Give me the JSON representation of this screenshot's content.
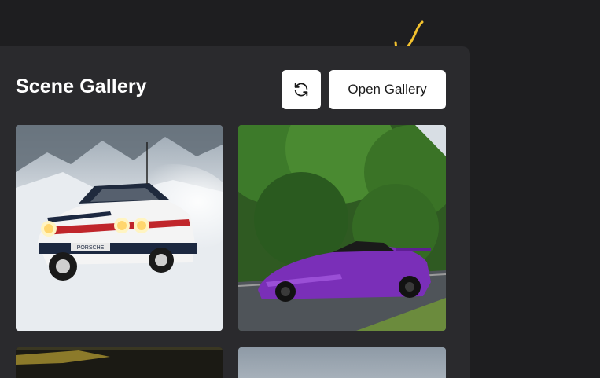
{
  "gallery": {
    "title": "Scene Gallery",
    "open_label": "Open Gallery",
    "refresh_icon": "refresh-icon",
    "annotation_icon": "arrow-annotation-icon"
  },
  "thumbnails": [
    {
      "name": "rally-porsche-snow",
      "plate": "PORSCHE"
    },
    {
      "name": "purple-lamborghini-road"
    },
    {
      "name": "night-scene"
    },
    {
      "name": "sky-scene"
    }
  ]
}
